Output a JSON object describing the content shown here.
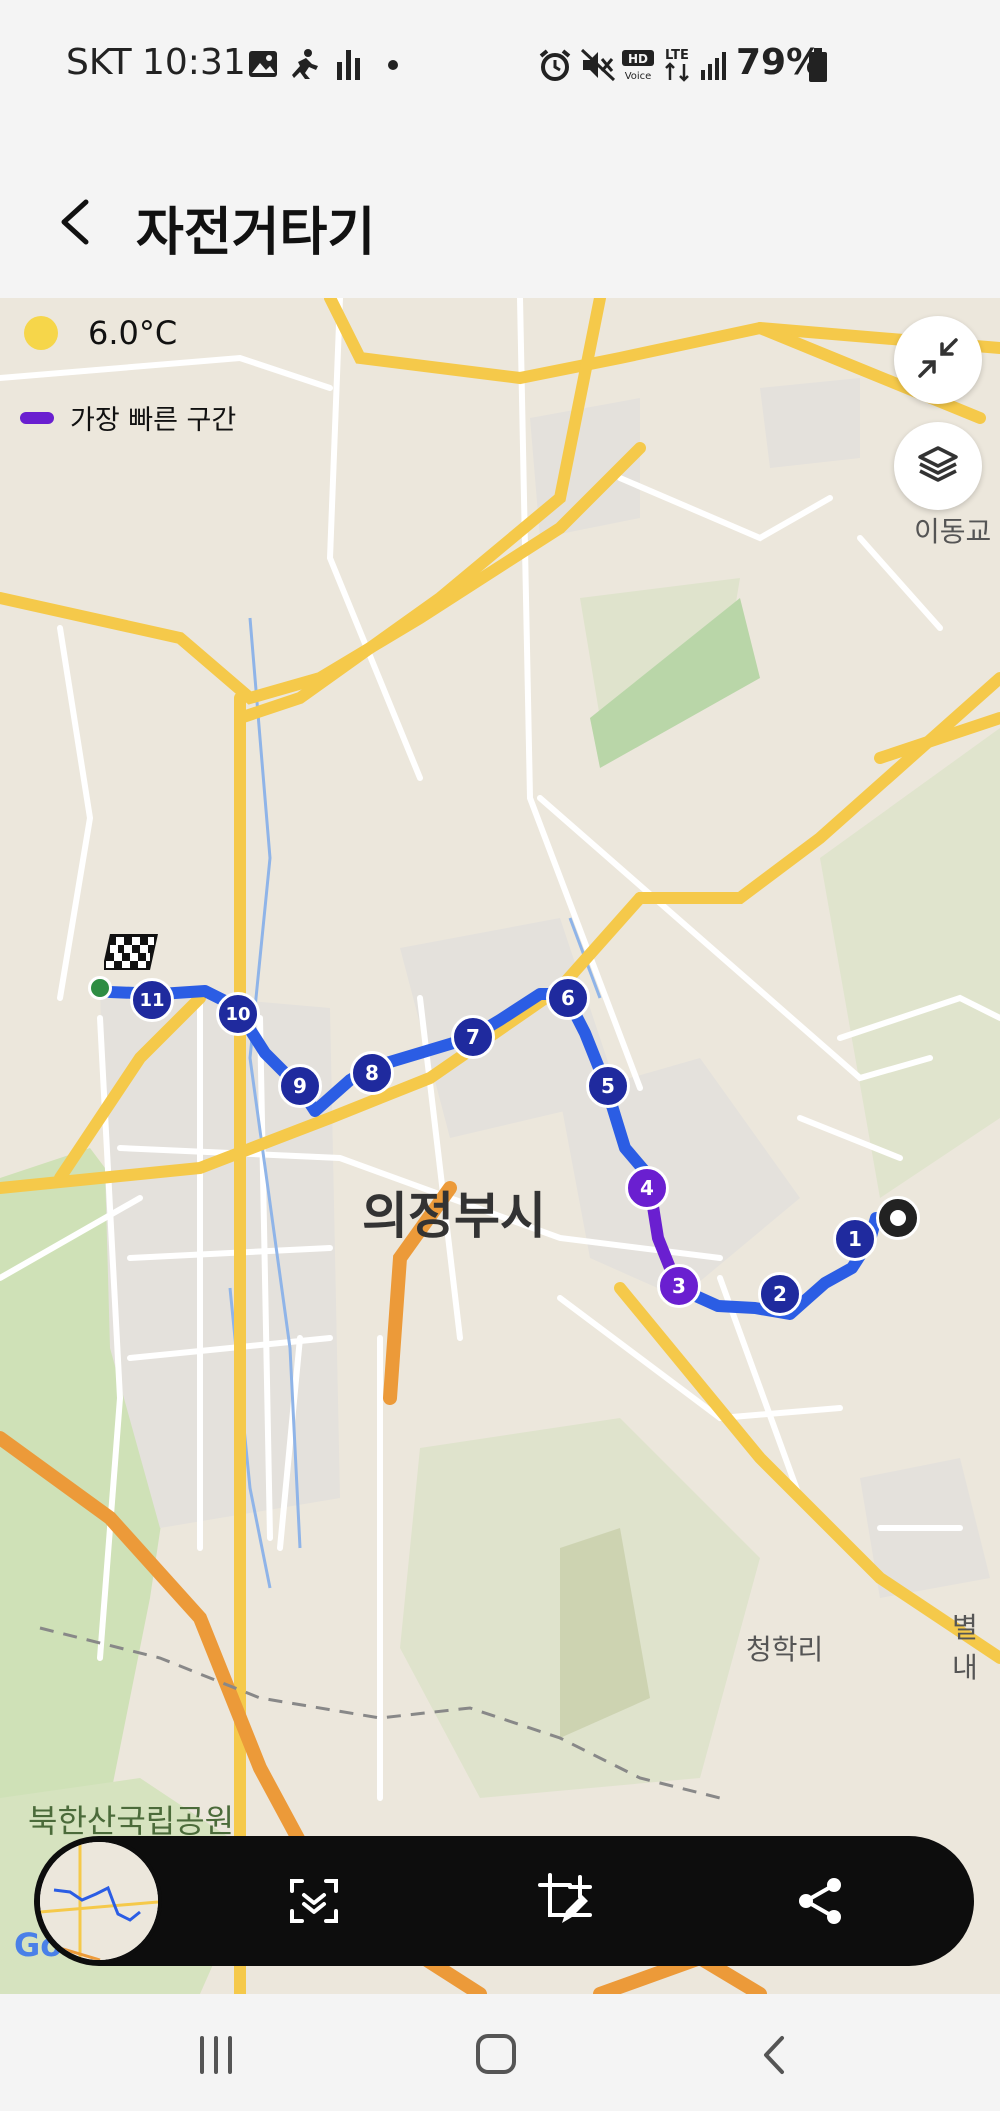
{
  "status_bar": {
    "carrier": "SKT",
    "time": "10:31",
    "battery": "79%",
    "left_icons": [
      "gallery-icon",
      "activity-icon",
      "equalizer-icon",
      "dot-icon"
    ],
    "right_icons": [
      "alarm-icon",
      "mute-icon",
      "hd-voice-icon",
      "lte-icon",
      "signal-icon",
      "battery-icon"
    ]
  },
  "header": {
    "title": "자전거타기",
    "back_icon": "chevron-left-icon"
  },
  "map": {
    "temperature": "6.0°C",
    "legend_label": "가장 빠른 구간",
    "legend_color": "#6a1fd0",
    "route_color": "#2b5de4",
    "marker_color": "#1f2a9e",
    "fastest_marker_color": "#6a1fd0",
    "city_label": "의정부시",
    "place_labels": {
      "park": "북한산국립공원",
      "cheonghak": "청학리",
      "idong": "이동교",
      "byeol": "별내"
    },
    "markers": [
      "1",
      "2",
      "3",
      "4",
      "5",
      "6",
      "7",
      "8",
      "9",
      "10",
      "11"
    ],
    "buttons": [
      "minimize-icon",
      "layers-icon"
    ],
    "google_logo": "Go"
  },
  "toolbar": {
    "icons": [
      "map-thumbnail",
      "scan-icon",
      "edit-crop-icon",
      "share-icon"
    ]
  },
  "nav_bar": {
    "icons": [
      "recents-icon",
      "home-icon",
      "back-icon"
    ]
  }
}
